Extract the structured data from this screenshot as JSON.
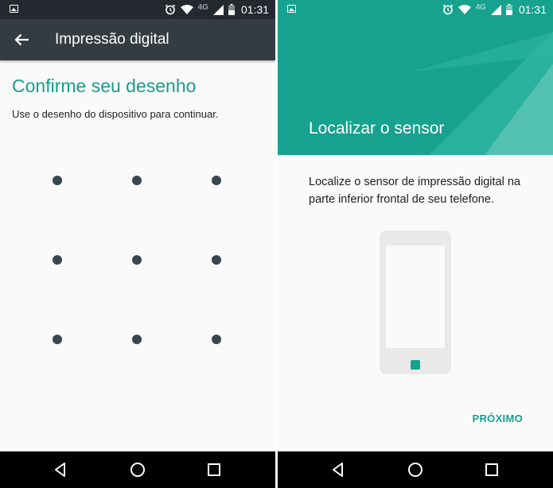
{
  "status_bar": {
    "time": "01:31",
    "network": "4G"
  },
  "left_screen": {
    "toolbar": {
      "title": "Impressão digital"
    },
    "heading": "Confirme seu desenho",
    "instruction": "Use o desenho do dispositivo para continuar.",
    "pattern_grid": {
      "rows": 3,
      "columns": 3
    }
  },
  "right_screen": {
    "banner_title": "Localizar o sensor",
    "description": "Localize o sensor de impressão digital na parte inferior frontal de seu telefone.",
    "next_label": "PRÓXIMO"
  },
  "icons": [
    "image-icon",
    "alarm-icon",
    "wifi-icon",
    "signal-icon",
    "battery-icon",
    "back-arrow-icon",
    "nav-back-icon",
    "nav-home-icon",
    "nav-recents-icon",
    "phone-illustration"
  ],
  "colors": {
    "accent": "#159e8c",
    "toolbar": "#343c43",
    "status_bar": "#23292e",
    "pattern_dot": "#37474f",
    "banner": "#16a28e"
  }
}
